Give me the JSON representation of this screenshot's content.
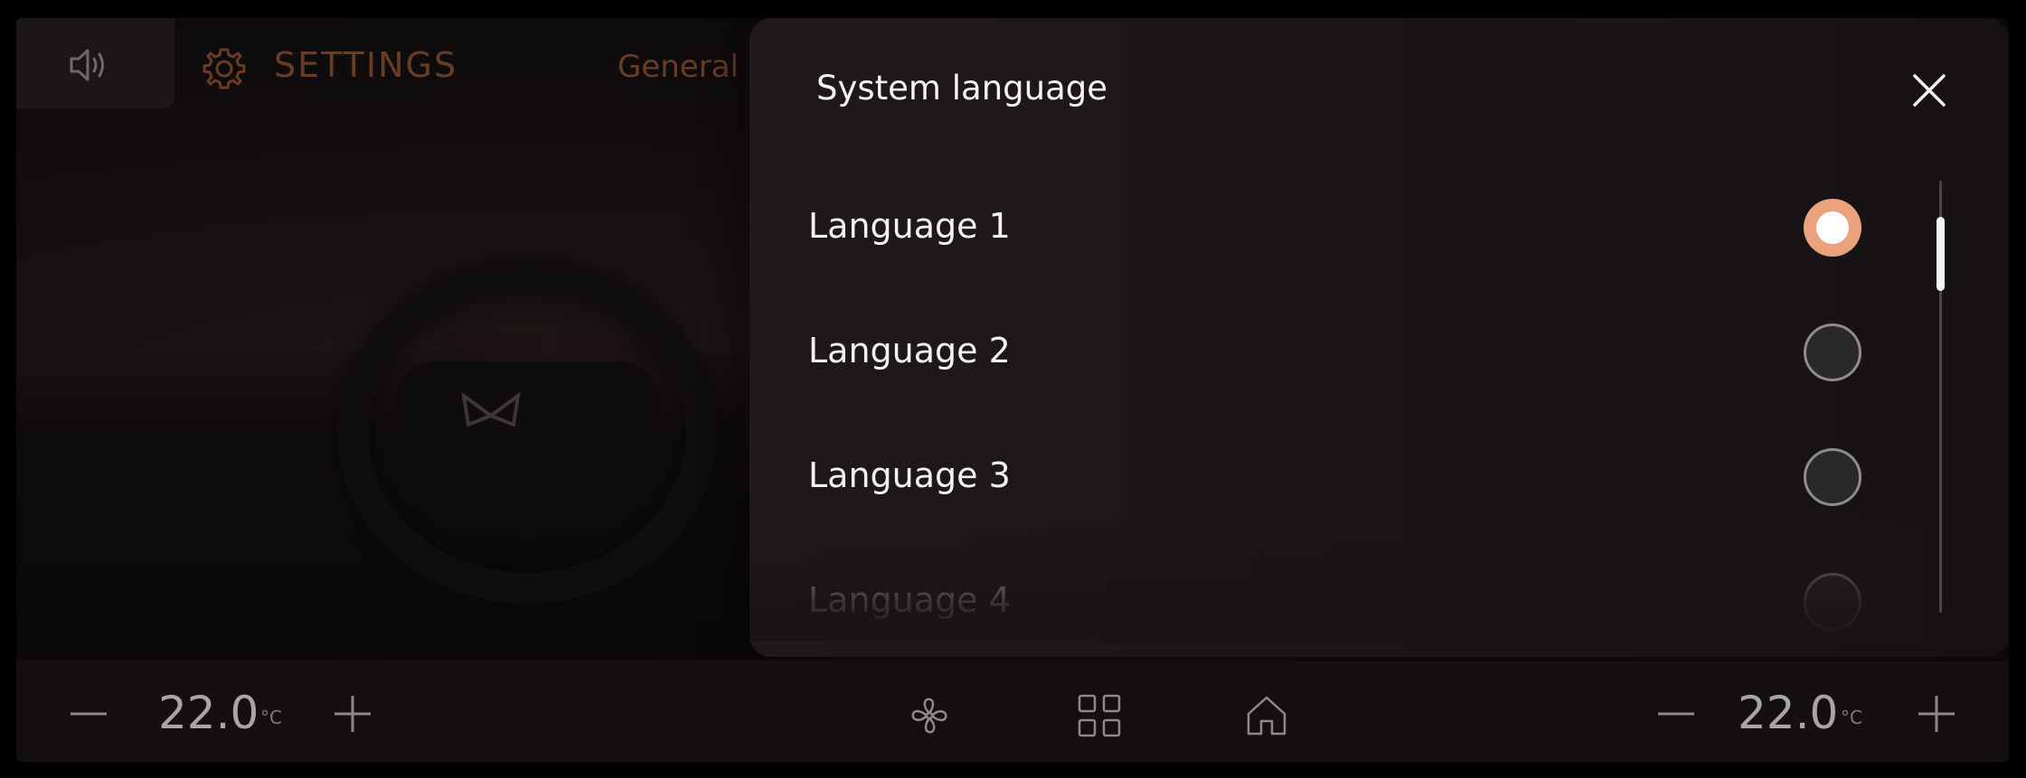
{
  "header": {
    "title": "SETTINGS",
    "tab_general": "General",
    "icons": {
      "volume": "volume-icon",
      "settings": "gear-icon"
    }
  },
  "dialog": {
    "title": "System language",
    "close_icon": "close-icon",
    "languages": [
      {
        "label": "Language 1",
        "selected": true
      },
      {
        "label": "Language 2",
        "selected": false
      },
      {
        "label": "Language 3",
        "selected": false
      },
      {
        "label": "Language 4",
        "selected": false
      }
    ]
  },
  "climate": {
    "left": {
      "value": "22.0",
      "unit": "°C"
    },
    "right": {
      "value": "22.0",
      "unit": "°C"
    }
  },
  "nav_icons": [
    "fan-icon",
    "apps-grid-icon",
    "home-icon"
  ],
  "colors": {
    "accent": "#e9a27c",
    "dim_accent_text": "#6a3c25",
    "background": "#141012",
    "dialog_background": "#1c1618"
  }
}
